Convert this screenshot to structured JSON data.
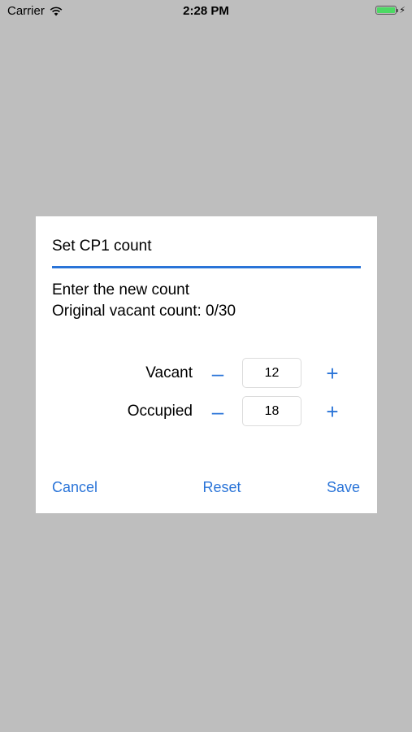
{
  "status_bar": {
    "carrier": "Carrier",
    "time": "2:28 PM",
    "battery_level": 1.0,
    "battery_color": "#4cd964"
  },
  "dialog": {
    "title": "Set CP1 count",
    "message_line1": "Enter the new count",
    "message_line2": "Original vacant count: 0/30",
    "rows": [
      {
        "label": "Vacant",
        "value": "12",
        "minus": "–",
        "plus": "+"
      },
      {
        "label": "Occupied",
        "value": "18",
        "minus": "–",
        "plus": "+"
      }
    ],
    "actions": {
      "cancel": "Cancel",
      "reset": "Reset",
      "save": "Save"
    },
    "accent_color": "#2a74d8"
  }
}
